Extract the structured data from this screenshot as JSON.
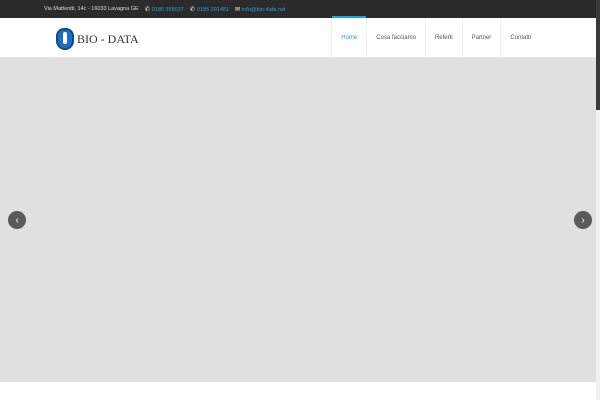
{
  "topbar": {
    "address": "Via Matteotti, 14c - 16033 Lavagna GE",
    "phone1": "0185 395037",
    "phone2": "0185 391481",
    "email": "info@bio-data.net"
  },
  "header": {
    "logo_text": "BIO - DATA"
  },
  "nav": [
    {
      "label": "Home"
    },
    {
      "label": "Cosa facciamo"
    },
    {
      "label": "Referti"
    },
    {
      "label": "Partner"
    },
    {
      "label": "Contatti"
    }
  ],
  "slider": {
    "prev": "‹",
    "next": "›"
  }
}
